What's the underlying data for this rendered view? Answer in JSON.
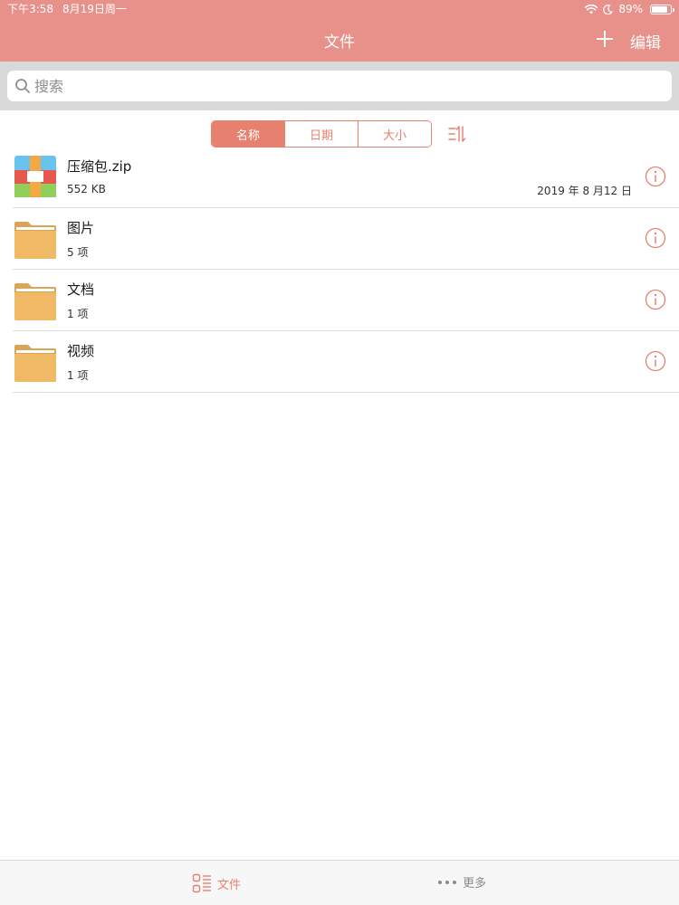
{
  "status_bar": {
    "time": "下午3:58",
    "date": "8月19日周一",
    "battery": "89%"
  },
  "nav": {
    "title": "文件",
    "add_icon": "plus-icon",
    "edit_label": "编辑"
  },
  "search": {
    "placeholder": "搜索",
    "value": ""
  },
  "sort": {
    "options": [
      "名称",
      "日期",
      "大小"
    ],
    "selected": "名称",
    "sort_icon": "sort-order-icon"
  },
  "files": [
    {
      "name": "压缩包.zip",
      "meta": "552 KB",
      "date": "2019 年 8 月12 日",
      "type": "zip"
    },
    {
      "name": "图片",
      "meta": "5 项",
      "date": "",
      "type": "folder"
    },
    {
      "name": "文档",
      "meta": "1 项",
      "date": "",
      "type": "folder"
    },
    {
      "name": "视频",
      "meta": "1 项",
      "date": "",
      "type": "folder"
    }
  ],
  "tab_bar": {
    "items": [
      {
        "label": "文件",
        "icon": "files-list-icon",
        "active": true
      },
      {
        "label": "更多",
        "icon": "more-dots-icon",
        "active": false
      }
    ]
  },
  "colors": {
    "accent": "#e8806f",
    "header": "#e8908a",
    "folder": "#efb965"
  }
}
